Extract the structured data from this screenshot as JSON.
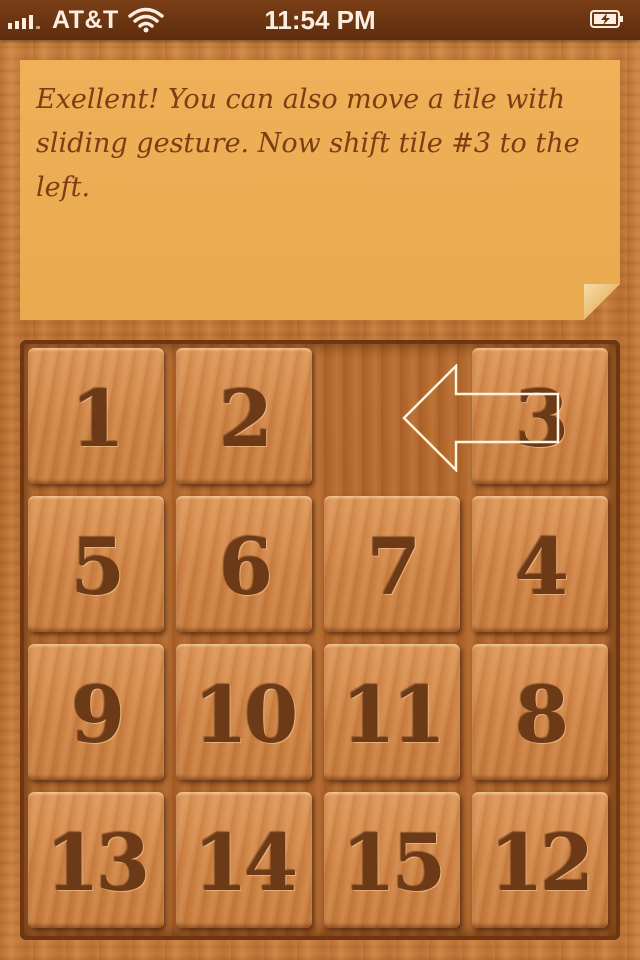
{
  "status_bar": {
    "carrier": "AT&T",
    "time": "11:54 PM",
    "icons": [
      "signal-icon",
      "wifi-icon",
      "battery-charging-icon"
    ]
  },
  "note": {
    "message": "Exellent! You can also move a tile with sliding gesture. Now shift tile #3 to the left."
  },
  "board": {
    "rows": 4,
    "cols": 4,
    "tiles": [
      [
        "1",
        "2",
        "",
        "3"
      ],
      [
        "5",
        "6",
        "7",
        "4"
      ],
      [
        "9",
        "10",
        "11",
        "8"
      ],
      [
        "13",
        "14",
        "15",
        "12"
      ]
    ],
    "hint_arrow": {
      "icon": "left-arrow-icon",
      "direction": "left"
    }
  },
  "colors": {
    "status_bar": "#6a3311",
    "note": "#eca954",
    "note_text": "#7a3e14",
    "tile": "#d08848",
    "tile_number": "#6d3a17"
  }
}
